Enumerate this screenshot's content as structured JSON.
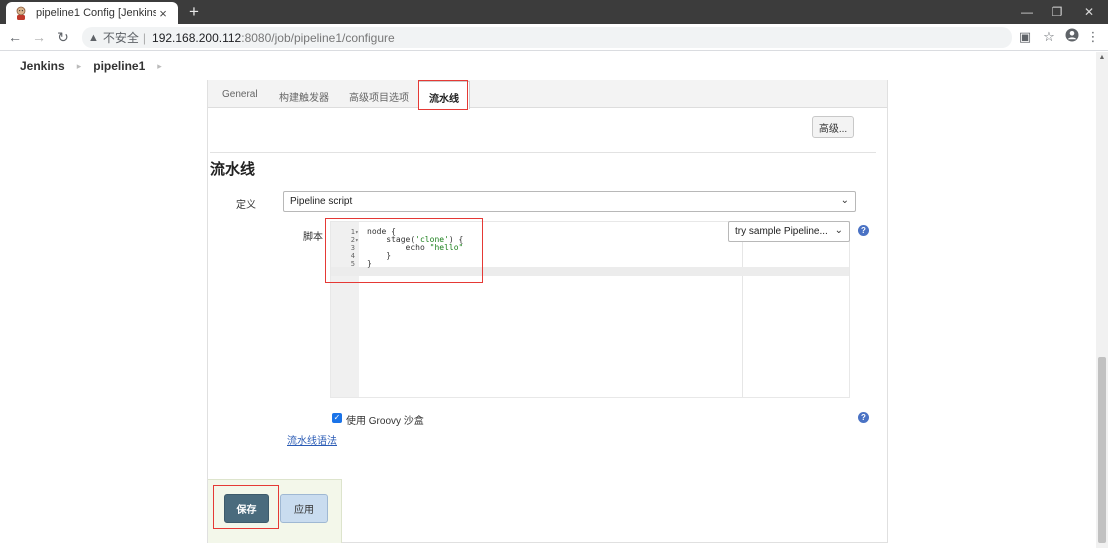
{
  "browser": {
    "tab_title": "pipeline1 Config [Jenkins]",
    "tab_close": "×",
    "new_tab": "+",
    "security_label": "不安全",
    "url_host": "192.168.200.112",
    "url_path": ":8080/job/pipeline1/configure",
    "icons": [
      "back-icon",
      "forward-icon",
      "reload-icon",
      "warning-icon",
      "translate-icon",
      "star-icon",
      "account-icon",
      "menu-icon"
    ]
  },
  "breadcrumb": {
    "items": [
      "Jenkins",
      "pipeline1"
    ]
  },
  "tabs": {
    "items": [
      "General",
      "构建触发器",
      "高级项目选项",
      "流水线"
    ],
    "active": "流水线"
  },
  "config": {
    "advanced_button": "高级...",
    "section_title": "流水线",
    "definition_label": "定义",
    "definition_value": "Pipeline script",
    "script_label": "脚本",
    "sample_select": "try sample Pipeline...",
    "code": [
      {
        "num": "1",
        "fold": "▾",
        "text": "node {"
      },
      {
        "num": "2",
        "fold": "▾",
        "text": "    stage('clone') {"
      },
      {
        "num": "3",
        "fold": "",
        "text": "        echo \"hello\""
      },
      {
        "num": "4",
        "fold": "",
        "text": "    }"
      },
      {
        "num": "5",
        "fold": "",
        "text": "}"
      }
    ],
    "sandbox_label": "使用 Groovy 沙盒",
    "sandbox_checked": true,
    "syntax_link": "流水线语法",
    "help_icon": "?"
  },
  "actions": {
    "save": "保存",
    "apply": "应用"
  },
  "colors": {
    "highlight": "#e53935",
    "save_button": "#4a6b7d",
    "apply_button": "#c9dcef",
    "checkbox": "#1a73e8",
    "help_icon": "#4a72c4"
  }
}
